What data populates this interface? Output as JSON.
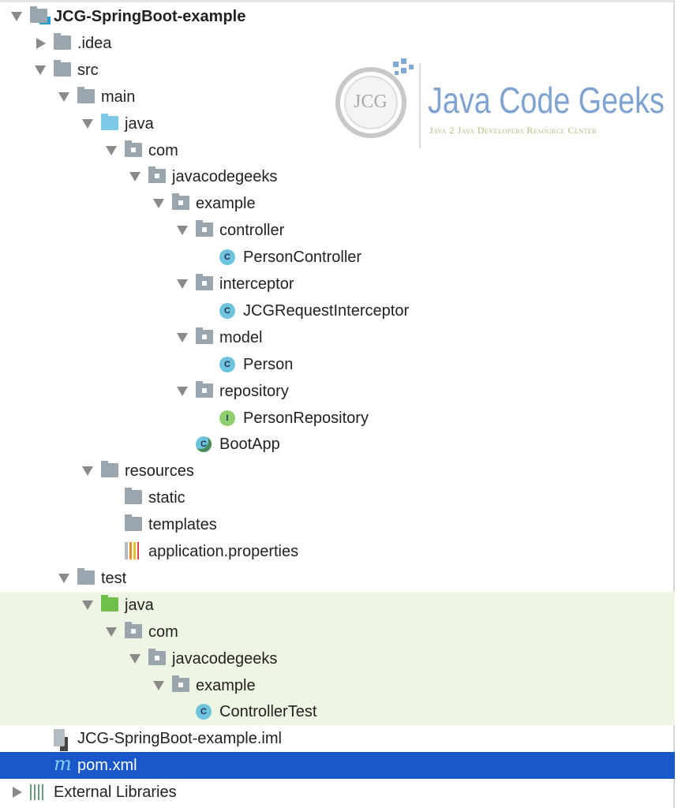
{
  "tree": [
    {
      "label": "JCG-SpringBoot-example",
      "level": 0,
      "arrow": "open",
      "icon": "module-folder",
      "bold": true
    },
    {
      "label": ".idea",
      "level": 1,
      "arrow": "closed",
      "icon": "folder"
    },
    {
      "label": "src",
      "level": 1,
      "arrow": "open",
      "icon": "folder"
    },
    {
      "label": "main",
      "level": 2,
      "arrow": "open",
      "icon": "folder"
    },
    {
      "label": "java",
      "level": 3,
      "arrow": "open",
      "icon": "source-folder"
    },
    {
      "label": "com",
      "level": 4,
      "arrow": "open",
      "icon": "package"
    },
    {
      "label": "javacodegeeks",
      "level": 5,
      "arrow": "open",
      "icon": "package"
    },
    {
      "label": "example",
      "level": 6,
      "arrow": "open",
      "icon": "package"
    },
    {
      "label": "controller",
      "level": 7,
      "arrow": "open",
      "icon": "package"
    },
    {
      "label": "PersonController",
      "level": 8,
      "icon": "class",
      "glyph": "C"
    },
    {
      "label": "interceptor",
      "level": 7,
      "arrow": "open",
      "icon": "package"
    },
    {
      "label": "JCGRequestInterceptor",
      "level": 8,
      "icon": "class",
      "glyph": "C"
    },
    {
      "label": "model",
      "level": 7,
      "arrow": "open",
      "icon": "package"
    },
    {
      "label": "Person",
      "level": 8,
      "icon": "class",
      "glyph": "C"
    },
    {
      "label": "repository",
      "level": 7,
      "arrow": "open",
      "icon": "package"
    },
    {
      "label": "PersonRepository",
      "level": 8,
      "icon": "interface",
      "glyph": "I"
    },
    {
      "label": "BootApp",
      "level": 7,
      "icon": "spring-boot-class",
      "glyph": "C"
    },
    {
      "label": "resources",
      "level": 3,
      "arrow": "open",
      "icon": "folder"
    },
    {
      "label": "static",
      "level": 4,
      "icon": "folder"
    },
    {
      "label": "templates",
      "level": 4,
      "icon": "folder"
    },
    {
      "label": "application.properties",
      "level": 4,
      "icon": "properties-file"
    },
    {
      "label": "test",
      "level": 2,
      "arrow": "open",
      "icon": "folder"
    },
    {
      "label": "java",
      "level": 3,
      "arrow": "open",
      "icon": "test-folder",
      "test": true
    },
    {
      "label": "com",
      "level": 4,
      "arrow": "open",
      "icon": "package",
      "test": true
    },
    {
      "label": "javacodegeeks",
      "level": 5,
      "arrow": "open",
      "icon": "package",
      "test": true
    },
    {
      "label": "example",
      "level": 6,
      "arrow": "open",
      "icon": "package",
      "test": true
    },
    {
      "label": "ControllerTest",
      "level": 7,
      "icon": "class",
      "glyph": "C",
      "test": true
    },
    {
      "label": "JCG-SpringBoot-example.iml",
      "level": 1,
      "icon": "iml-file"
    },
    {
      "label": "pom.xml",
      "level": 1,
      "icon": "maven-file",
      "glyph": "m",
      "selected": true
    },
    {
      "label": "External Libraries",
      "level": 0,
      "arrow": "closed",
      "icon": "libraries"
    }
  ],
  "watermark": {
    "title": "Java Code Geeks",
    "subtitle": "Java 2 Java Developers Resource Center",
    "badge": "JCG"
  },
  "colors": {
    "selection": "#1a57c9",
    "test_bg": "#eef5e4",
    "class_icon": "#6ec4dc",
    "interface_icon": "#8fcf6f"
  }
}
